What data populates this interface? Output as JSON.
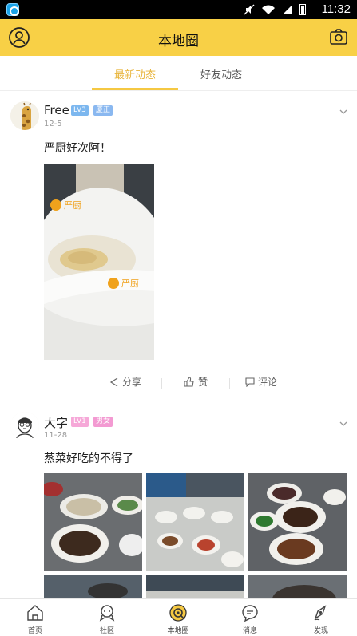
{
  "status_bar": {
    "time": "11:32",
    "icons": [
      "app-icon",
      "mute-icon",
      "wifi-icon",
      "signal-icon",
      "battery-icon"
    ]
  },
  "header": {
    "title": "本地圈",
    "left_icon": "user-icon",
    "right_icon": "camera-icon"
  },
  "tabs": [
    {
      "label": "最新动态",
      "active": true
    },
    {
      "label": "好友动态",
      "active": false
    }
  ],
  "posts": [
    {
      "username": "Free",
      "level": "LV3",
      "tag": "厦正",
      "date": "12-5",
      "text": "严厨好次阿！",
      "actions": {
        "share": "分享",
        "like": "赞",
        "comment": "评论"
      },
      "photo_caption": "严厨 严厨"
    },
    {
      "username": "大字",
      "level": "LV1",
      "tag": "男女",
      "date": "11-28",
      "text": "蒸菜好吃的不得了"
    }
  ],
  "bottom_nav": [
    {
      "label": "首页",
      "icon": "home-icon",
      "active": false
    },
    {
      "label": "社区",
      "icon": "community-icon",
      "active": false
    },
    {
      "label": "本地圈",
      "icon": "local-circle-icon",
      "active": true
    },
    {
      "label": "消息",
      "icon": "message-icon",
      "active": false
    },
    {
      "label": "发现",
      "icon": "discover-icon",
      "active": false
    }
  ],
  "colors": {
    "accent": "#f8d046",
    "tab_active": "#e8b43a",
    "badge_level_blue": "#7cb7ef",
    "badge_tag_blue": "#8ab8f0",
    "badge_level_pink": "#f6a8d8",
    "badge_tag_pink": "#f39ad2"
  }
}
